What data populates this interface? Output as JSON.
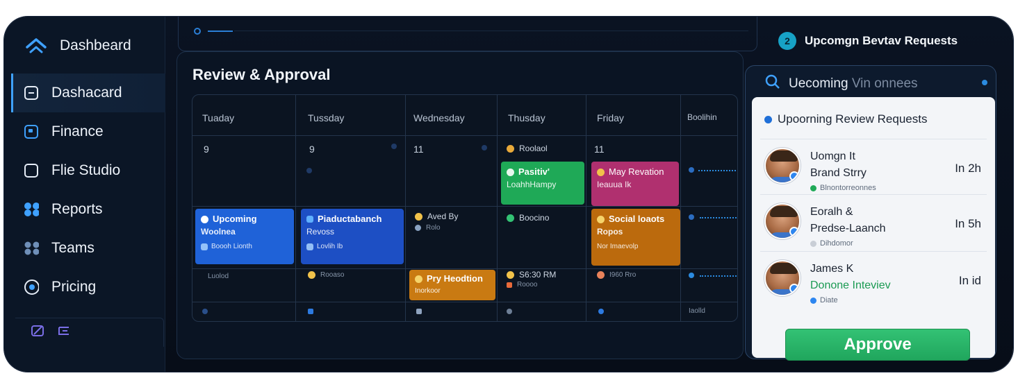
{
  "sidebar": {
    "brand": "Dashbeard",
    "items": [
      {
        "label": "Dashacard",
        "icon": "square-dash-icon",
        "active": true
      },
      {
        "label": "Finance",
        "icon": "finance-icon",
        "active": false
      },
      {
        "label": "Flie Studio",
        "icon": "square-icon",
        "active": false
      },
      {
        "label": "Reports",
        "icon": "reports-dots-icon",
        "active": false
      },
      {
        "label": "Teams",
        "icon": "teams-icon",
        "active": false
      },
      {
        "label": "Pricing",
        "icon": "circle-icon",
        "active": false
      }
    ]
  },
  "main": {
    "title": "Review & Approval",
    "days": [
      "Tuaday",
      "Tussday",
      "Wednesday",
      "Thusday",
      "Friday",
      "Boolihin"
    ],
    "dates": [
      "9",
      "9",
      "11",
      "11"
    ],
    "events": {
      "thu_top": "Roolaol",
      "green": {
        "title": "Pasitiv'",
        "sub": "LoahhHampy"
      },
      "pink": {
        "title": "May Revation",
        "sub": "Ieauua Ik"
      },
      "blue1": {
        "title": "Upcoming",
        "sub": "Woolnea",
        "tiny": "Boooh Lionth"
      },
      "blue2": {
        "title": "Piaductabanch",
        "sub": "Revoss",
        "tiny": "Lovlih Ib"
      },
      "wed_mid": {
        "title": "Aved By",
        "sub": "Rolo"
      },
      "thu_mid": "Boocino",
      "orange_social": {
        "title": "Social loaots",
        "sub": "Ropos",
        "tiny": "Nor Imaevolp"
      },
      "tue_bottom": "Luolod",
      "tus_bottom": "Rooaso",
      "orange_pry": {
        "title": "Pry Heodtion",
        "sub": "Inorkoor"
      },
      "thu_bottom": {
        "title": "S6:30 RM",
        "sub": "Roooo"
      },
      "fri_bottom": "I960 Rro",
      "boo_bottom": "Iaolld"
    }
  },
  "right": {
    "header": "Upcomgn Bevtav Requests",
    "search_text": "Uecoming",
    "search_muted": "Vin onnees",
    "card_title": "Upoorning Review Requests",
    "requests": [
      {
        "name": "Uomgn It",
        "title": "Brand Strry",
        "meta": "Blnontorreonnes",
        "when": "In 2h",
        "title_color": "dark",
        "meta_dot": "#1fa957"
      },
      {
        "name": "Eoralh &",
        "title": "Predse-Laanch",
        "meta": "Dihdomor",
        "when": "In 5h",
        "title_color": "dark",
        "meta_dot": "#c9ced6"
      },
      {
        "name": "James K",
        "title": "Donone Inteviev",
        "meta": "Diate",
        "when": "In id",
        "title_color": "green",
        "meta_dot": "#2d86f0"
      }
    ],
    "approve_label": "Approve"
  },
  "colors": {
    "accent": "#2b8be0",
    "approve": "#22a85e",
    "event_blue": "#1f62d8",
    "event_green": "#1fa957",
    "event_pink": "#b0306f",
    "event_orange": "#bb6a0d"
  }
}
